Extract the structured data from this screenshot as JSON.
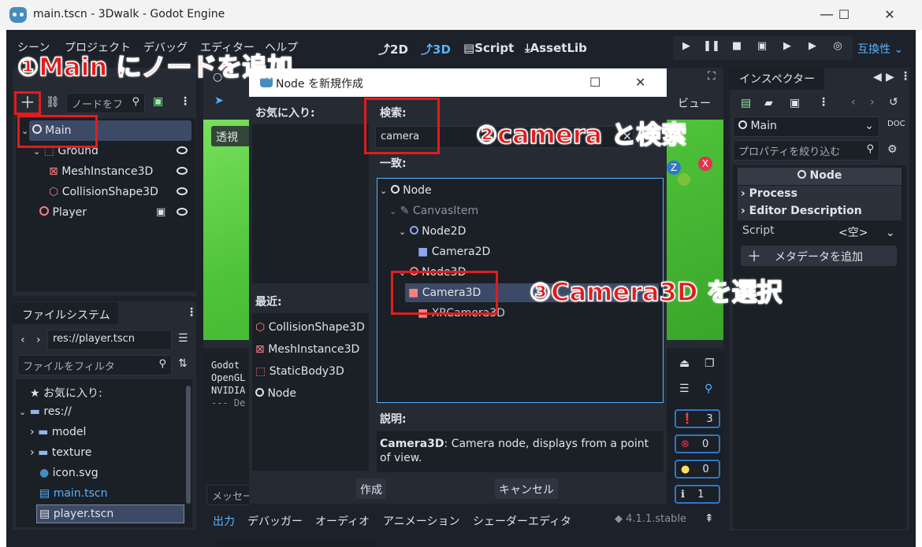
{
  "window": {
    "title": "main.tscn - 3Dwalk - Godot Engine",
    "minimize": "—",
    "maximize": "☐",
    "close": "✕"
  },
  "menu": [
    "シーン",
    "プロジェクト",
    "デバッグ",
    "エディター",
    "ヘルプ"
  ],
  "main_tabs": {
    "tab2d": "2D",
    "tab3d": "3D",
    "script": "Script",
    "assetlib": "AssetLib"
  },
  "renderer": "互換性",
  "scene_panel": {
    "filter_placeholder": "ノードをフ",
    "nodes": [
      {
        "label": "Main"
      },
      {
        "label": "Ground"
      },
      {
        "label": "MeshInstance3D"
      },
      {
        "label": "CollisionShape3D"
      },
      {
        "label": "Player"
      }
    ]
  },
  "filesystem": {
    "tab": "ファイルシステム",
    "path": "res://player.tscn",
    "filter_placeholder": "ファイルをフィルタ",
    "items": [
      {
        "label": "お気に入り:"
      },
      {
        "label": "res://"
      },
      {
        "label": "model"
      },
      {
        "label": "texture"
      },
      {
        "label": "icon.svg"
      },
      {
        "label": "main.tscn"
      },
      {
        "label": "player.tscn"
      }
    ]
  },
  "viewport": {
    "perspective": "透視",
    "view_menu": "ビュー",
    "z_axis": "Z",
    "x_axis": "X"
  },
  "output": {
    "lines": [
      "Godot",
      "OpenGL",
      "NVIDIA",
      "",
      "--- De"
    ],
    "message_placeholder": "メッセー"
  },
  "bottom_tabs": [
    "出力",
    "デバッガー",
    "オーディオ",
    "アニメーション",
    "シェーダーエディタ"
  ],
  "version": "4.1.1.stable",
  "counters": {
    "messages": "3",
    "errors": "0",
    "warnings": "0",
    "info": "1"
  },
  "inspector": {
    "tab": "インスペクター",
    "node_name": "Main",
    "filter_placeholder": "プロパティを絞り込む",
    "class_header": "Node",
    "sections": [
      "Process",
      "Editor Description"
    ],
    "script_label": "Script",
    "script_value": "<空>",
    "add_metadata": "メタデータを追加"
  },
  "dialog": {
    "title": "Node を新規作成",
    "favorites_label": "お気に入り:",
    "recent_label": "最近:",
    "recent": [
      "CollisionShape3D",
      "MeshInstance3D",
      "StaticBody3D",
      "Node"
    ],
    "search_label": "検索:",
    "search_value": "camera",
    "matches_label": "一致:",
    "tree": [
      "Node",
      "CanvasItem",
      "Node2D",
      "Camera2D",
      "Node3D",
      "Camera3D",
      "XRCamera3D"
    ],
    "description_label": "説明:",
    "description_class": "Camera3D",
    "description_text": ": Camera node, displays from a point of view.",
    "create_button": "作成",
    "cancel_button": "キャンセル",
    "maximize": "☐",
    "close": "✕"
  },
  "annotations": {
    "step1": "①Main にノードを追加",
    "step2": "②camera と検索",
    "step3": "③Camera3D を選択"
  },
  "colors": {
    "annotation": "#e21c1c",
    "accent": "#57b3ff",
    "editor_bg": "#252a33"
  }
}
